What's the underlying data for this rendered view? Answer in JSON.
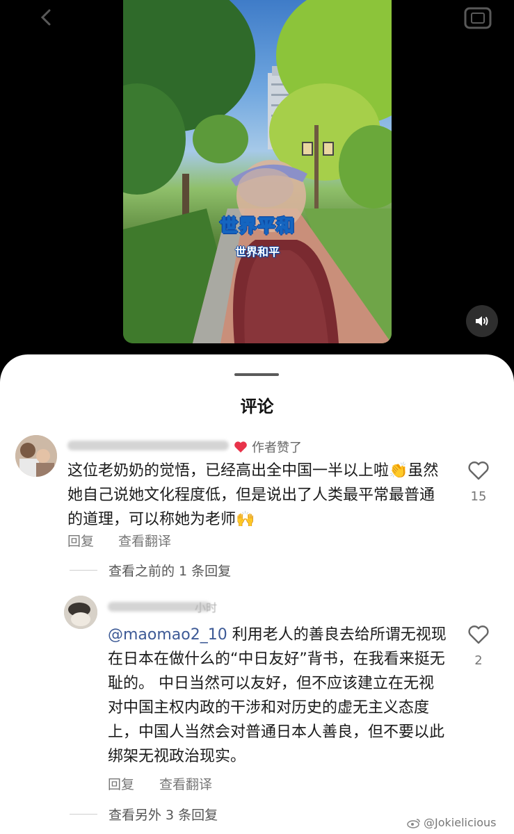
{
  "video": {
    "caption_main": "世界平和",
    "caption_sub": "世界和平",
    "volume_icon": "speaker-icon"
  },
  "sheet": {
    "title": "评论"
  },
  "comments": [
    {
      "author_liked_label": "作者赞了",
      "text": "这位老奶奶的觉悟，已经高出全中国一半以上啦👏虽然她自己说她文化程度低，但是说出了人类最平常最普通的道理，可以称她为老师🙌",
      "likes": "15",
      "reply_label": "回复",
      "translate_label": "查看翻译",
      "more_replies": "查看之前的 1 条回复"
    },
    {
      "name_tail": "小时",
      "mention": "@maomao2_10",
      "text": "利用老人的善良去给所谓无视现在日本在做什么的“中日友好”背书，在我看来挺无耻的。 中日当然可以友好，但不应该建立在无视对中国主权内政的干涉和对历史的虚无主义态度上，中国人当然会对普通日本人善良，但不要以此绑架无视政治现实。",
      "likes": "2",
      "reply_label": "回复",
      "translate_label": "查看翻译",
      "more_replies": "查看另外 3 条回复"
    }
  ],
  "watermark": "@Jokielicious",
  "colors": {
    "heart_red": "#e8334a",
    "mention_blue": "#3d5a96",
    "caption_blue": "#1565c0"
  }
}
